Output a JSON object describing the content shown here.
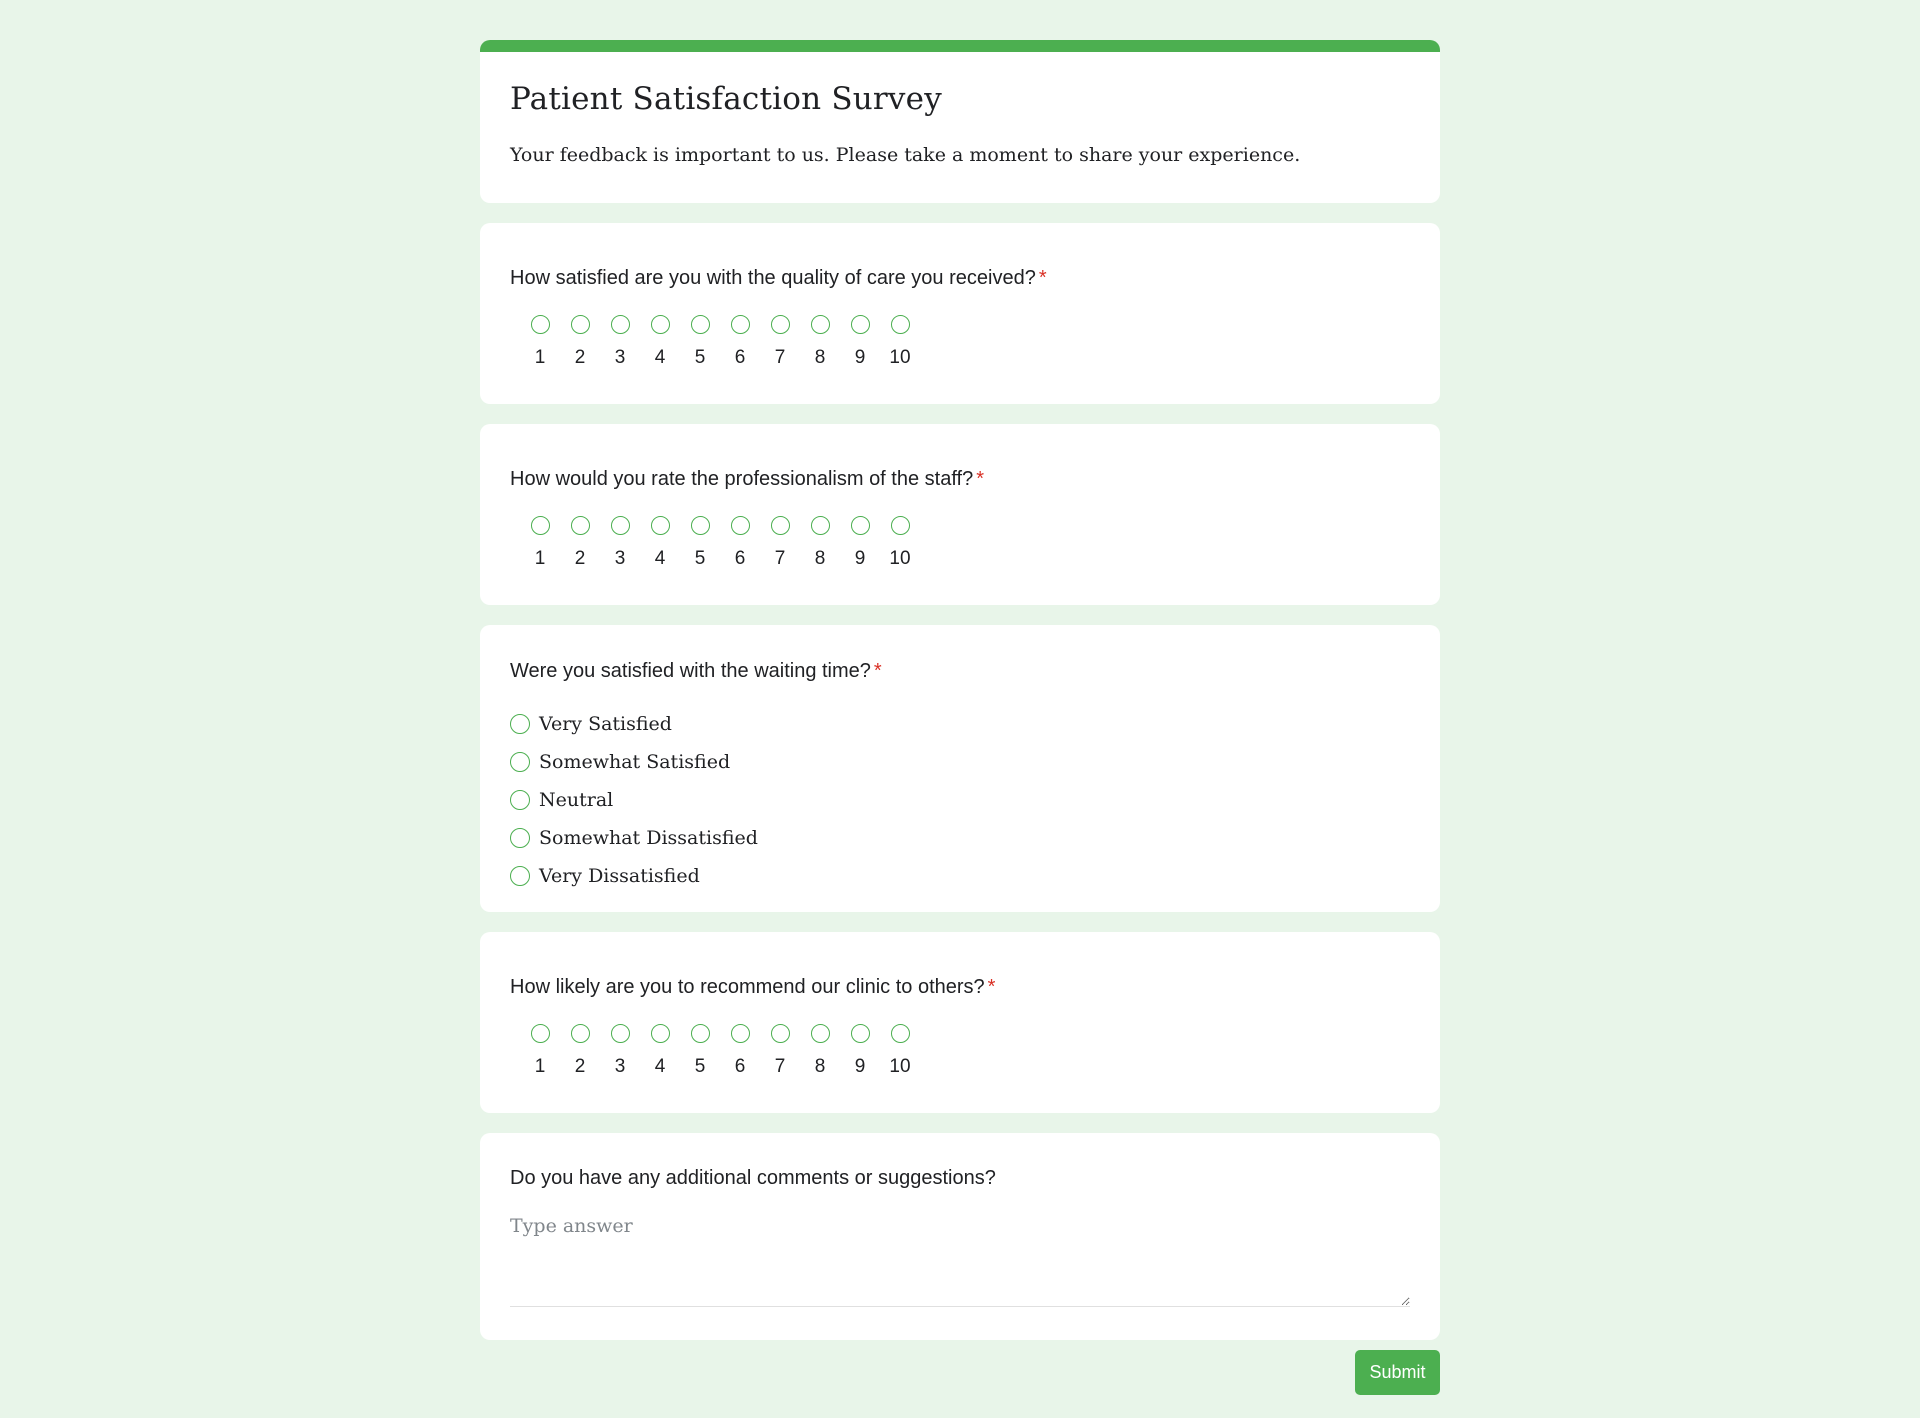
{
  "form": {
    "title": "Patient Satisfaction Survey",
    "description": "Your feedback is important to us. Please take a moment to share your experience.",
    "accent_color": "#4caf50",
    "background_color": "#e8f5e9",
    "required_marker": "*",
    "required_color": "#d93025"
  },
  "q1": {
    "text": "How satisfied are you with the quality of care you received?",
    "required": true,
    "scale": [
      "1",
      "2",
      "3",
      "4",
      "5",
      "6",
      "7",
      "8",
      "9",
      "10"
    ]
  },
  "q2": {
    "text": "How would you rate the professionalism of the staff?",
    "required": true,
    "scale": [
      "1",
      "2",
      "3",
      "4",
      "5",
      "6",
      "7",
      "8",
      "9",
      "10"
    ]
  },
  "q3": {
    "text": "Were you satisfied with the waiting time?",
    "required": true,
    "options": [
      "Very Satisfied",
      "Somewhat Satisfied",
      "Neutral",
      "Somewhat Dissatisfied",
      "Very Dissatisfied"
    ]
  },
  "q4": {
    "text": "How likely are you to recommend our clinic to others?",
    "required": true,
    "scale": [
      "1",
      "2",
      "3",
      "4",
      "5",
      "6",
      "7",
      "8",
      "9",
      "10"
    ]
  },
  "q5": {
    "text": "Do you have any additional comments or suggestions?",
    "required": false,
    "value": "",
    "placeholder": "Type answer"
  },
  "submit": {
    "label": "Submit"
  }
}
